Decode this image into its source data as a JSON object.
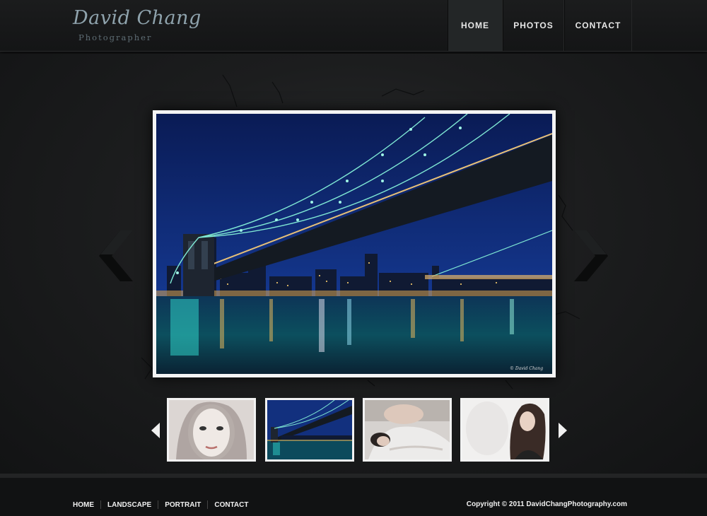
{
  "logo": {
    "name": "David Chang",
    "subtitle": "Photographer"
  },
  "nav": [
    {
      "label": "HOME",
      "active": true
    },
    {
      "label": "PHOTOS",
      "active": false
    },
    {
      "label": "CONTACT",
      "active": false
    }
  ],
  "slideshow": {
    "current_photo": "brooklyn-bridge-night",
    "thumbnails": [
      "woman-portrait-closeup",
      "brooklyn-bridge-night",
      "woman-lying-portrait",
      "woman-white-portrait"
    ],
    "selected_thumbnail": 1,
    "prev_icon": "chevron-left-icon",
    "next_icon": "chevron-right-icon"
  },
  "footer": {
    "links": [
      "HOME",
      "LANDSCAPE",
      "PORTRAIT",
      "CONTACT"
    ],
    "copyright": "Copyright © 2011 DavidChangPhotography.com"
  },
  "colors": {
    "background": "#151617",
    "accent": "#8fa3ad",
    "frame": "#f4f4f4"
  }
}
